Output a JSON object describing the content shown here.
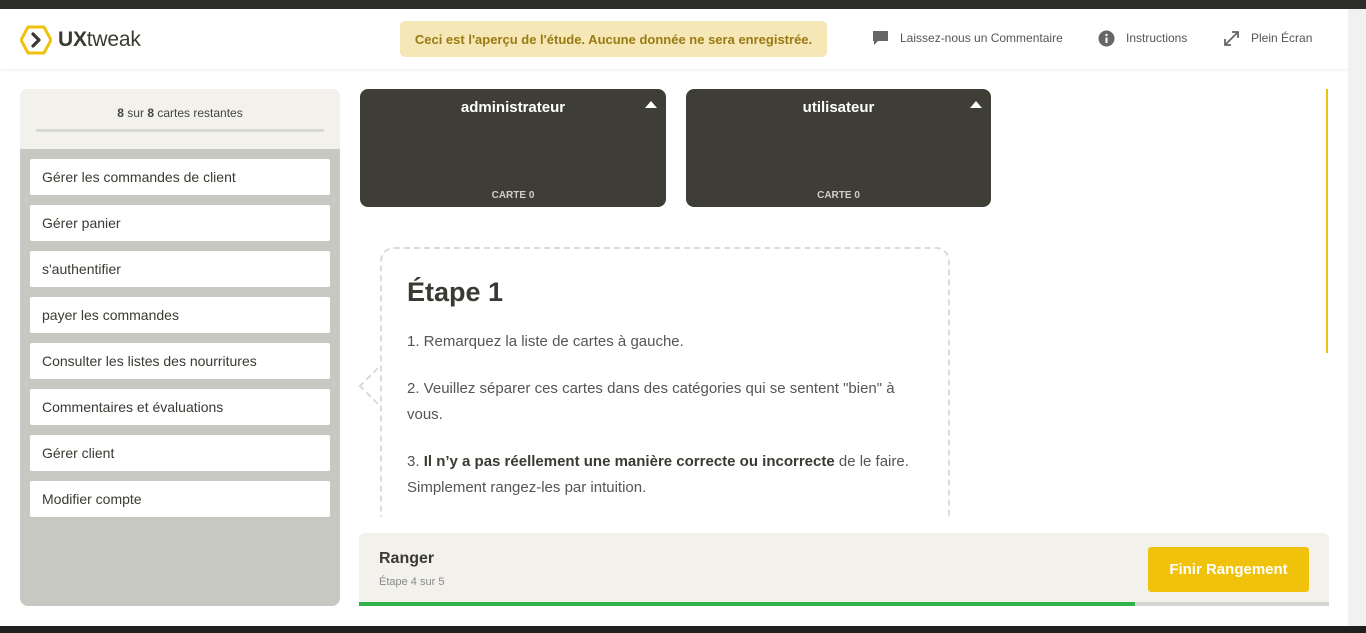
{
  "header": {
    "logo_text_bold": "UX",
    "logo_text": "tweak",
    "banner": "Ceci est l'aperçu de l'étude. Aucune donnée ne sera enregistrée.",
    "links": [
      {
        "label": "Laissez-nous un Commentaire",
        "icon": "comment-icon"
      },
      {
        "label": "Instructions",
        "icon": "info-icon"
      },
      {
        "label": "Plein Écran",
        "icon": "fullscreen-icon"
      }
    ]
  },
  "sidebar": {
    "remaining_count": "8",
    "remaining_sep": "sur",
    "remaining_total": "8",
    "remaining_label": "cartes restantes",
    "cards": [
      "Gérer les commandes de client",
      "Gérer panier",
      "s'authentifier",
      "payer les commandes",
      "Consulter les listes des nourritures",
      "Commentaires et évaluations",
      "Gérer client",
      "Modifier compte"
    ]
  },
  "categories": [
    {
      "title": "administrateur",
      "count_label": "CARTE 0"
    },
    {
      "title": "utilisateur",
      "count_label": "CARTE 0"
    }
  ],
  "instructions": {
    "title": "Étape 1",
    "step1": "1. Remarquez la liste de cartes à gauche.",
    "step2": "2. Veuillez séparer ces cartes dans des catégories qui se sentent \"bien\" à vous.",
    "step3_prefix": "3. ",
    "step3_bold": "Il n’y a pas réellement une manière correcte ou incorrecte",
    "step3_suffix": " de le faire. Simplement rangez-les par intuition."
  },
  "footer": {
    "title": "Ranger",
    "step": "Étape 4 sur 5",
    "button": "Finir Rangement",
    "progress": 0.8
  },
  "colors": {
    "accent": "#f0c20c",
    "dark_card": "#3f3e36",
    "progress": "#2fb24c"
  }
}
